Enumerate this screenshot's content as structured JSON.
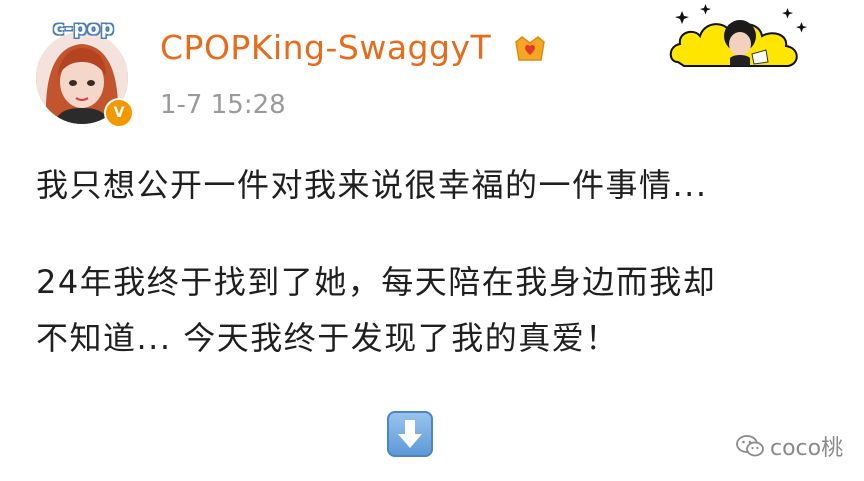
{
  "avatar": {
    "badge_text": "c-pop",
    "verified_mark": "V"
  },
  "header": {
    "username": "CPOPKing-SwaggyT",
    "timestamp": "1-7 15:28",
    "vip_icon": "crown-heart-icon"
  },
  "post": {
    "lines": [
      "我只想公开一件对我来说很幸福的一件事情...",
      "24年我终于找到了她，每天陪在我身边而我却",
      "不知道... 今天我终于发现了我的真爱！"
    ],
    "arrow_icon": "down-arrow-icon"
  },
  "watermark": {
    "text": "coco桃",
    "icon": "wechat-icon"
  },
  "colors": {
    "username": "#e86a1a",
    "timestamp": "#9a9a9a",
    "verified": "#f39800",
    "sticker_cloud": "#ffe600"
  }
}
